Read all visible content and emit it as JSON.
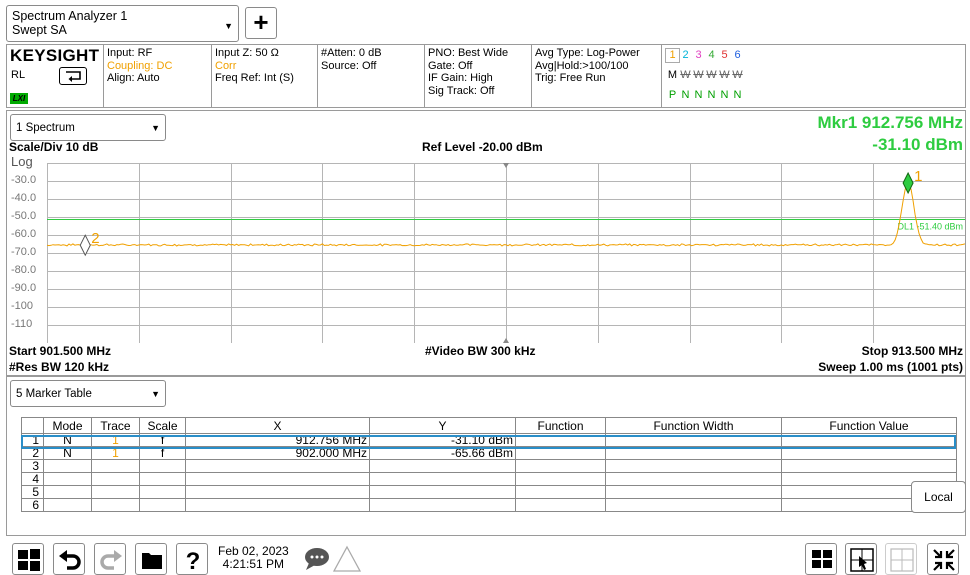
{
  "app": {
    "mode_line1": "Spectrum Analyzer 1",
    "mode_line2": "Swept SA",
    "add_label": "+"
  },
  "settings": {
    "brand": "KEYSIGHT",
    "rl": "RL",
    "lxi": "LXI",
    "col2": {
      "line1": "Input: RF",
      "line2": "Coupling: DC",
      "line3": "Align: Auto"
    },
    "col3": {
      "line1": "Input Z: 50 Ω",
      "line2": "Corr",
      "line3": "Freq Ref: Int (S)"
    },
    "col4": {
      "line1": "#Atten: 0 dB",
      "line2": "Source: Off"
    },
    "col5": {
      "line1": "PNO: Best Wide",
      "line2": "Gate: Off",
      "line3": "IF Gain: High",
      "line4": "Sig Track: Off"
    },
    "col6": {
      "line1": "Avg Type: Log-Power",
      "line2": "Avg|Hold:>100/100",
      "line3": "Trig: Free Run"
    },
    "traces": {
      "numbers": [
        "1",
        "2",
        "3",
        "4",
        "5",
        "6"
      ],
      "number_colors": [
        "#f0a000",
        "#00b4d8",
        "#e040c0",
        "#33aa33",
        "#e03030",
        "#2060e0"
      ],
      "type_prefix": "M",
      "types": [
        "W",
        "W",
        "W",
        "W",
        "W"
      ],
      "detectors": [
        "P",
        "N",
        "N",
        "N",
        "N",
        "N"
      ]
    }
  },
  "spectrum": {
    "window_label": "1 Spectrum",
    "marker_freq": "Mkr1  912.756 MHz",
    "marker_amp": "-31.10 dBm",
    "scale_div": "Scale/Div 10 dB",
    "ref_level": "Ref Level -20.00 dBm",
    "log_label": "Log",
    "y_labels": [
      "-30.0",
      "-40.0",
      "-50.0",
      "-60.0",
      "-70.0",
      "-80.0",
      "-90.0",
      "-100",
      "-110"
    ],
    "start": "Start 901.500 MHz",
    "res_bw": "#Res BW 120 kHz",
    "video_bw": "#Video BW 300 kHz",
    "stop": "Stop 913.500 MHz",
    "sweep": "Sweep 1.00 ms (1001 pts)",
    "display_line_label": "DL1 -51.40 dBm",
    "marker1_label": "1",
    "marker2_label": "2"
  },
  "chart_data": {
    "type": "line",
    "x_unit": "MHz",
    "y_unit": "dBm",
    "xlim": [
      901.5,
      913.5
    ],
    "ylim": [
      -120,
      -20
    ],
    "x_divisions": 10,
    "y_divisions": 10,
    "reference_level": -20.0,
    "scale_per_div": 10,
    "display_line": -51.4,
    "noise_floor": -65.7,
    "peak": {
      "x": 912.756,
      "y": -31.1
    },
    "markers": [
      {
        "name": "1",
        "x": 912.756,
        "y": -31.1
      },
      {
        "name": "2",
        "x": 902.0,
        "y": -65.66
      }
    ],
    "trace_color": "#f0a000",
    "display_line_color": "#2ecc40",
    "marker_color": "#2ecc40"
  },
  "table": {
    "window_label": "5 Marker Table",
    "headers": [
      "",
      "Mode",
      "Trace",
      "Scale",
      "X",
      "Y",
      "Function",
      "Function Width",
      "Function Value"
    ],
    "rows": [
      {
        "idx": "1",
        "mode": "N",
        "trace": "1",
        "scale": "f",
        "x": "912.756 MHz",
        "y": "-31.10 dBm",
        "func": "",
        "width": "",
        "value": ""
      },
      {
        "idx": "2",
        "mode": "N",
        "trace": "1",
        "scale": "f",
        "x": "902.000 MHz",
        "y": "-65.66 dBm",
        "func": "",
        "width": "",
        "value": ""
      },
      {
        "idx": "3",
        "mode": "",
        "trace": "",
        "scale": "",
        "x": "",
        "y": "",
        "func": "",
        "width": "",
        "value": ""
      },
      {
        "idx": "4",
        "mode": "",
        "trace": "",
        "scale": "",
        "x": "",
        "y": "",
        "func": "",
        "width": "",
        "value": ""
      },
      {
        "idx": "5",
        "mode": "",
        "trace": "",
        "scale": "",
        "x": "",
        "y": "",
        "func": "",
        "width": "",
        "value": ""
      },
      {
        "idx": "6",
        "mode": "",
        "trace": "",
        "scale": "",
        "x": "",
        "y": "",
        "func": "",
        "width": "",
        "value": ""
      }
    ],
    "local_label": "Local"
  },
  "status": {
    "date": "Feb 02, 2023",
    "time": "4:21:51 PM"
  }
}
